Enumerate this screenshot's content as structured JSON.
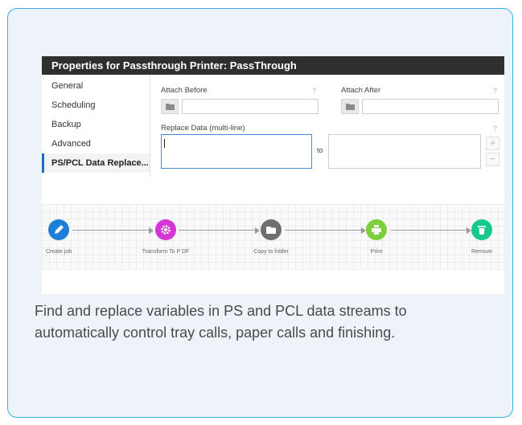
{
  "dialog": {
    "title": "Properties for Passthrough Printer: PassThrough",
    "nav": [
      {
        "label": "General"
      },
      {
        "label": "Scheduling"
      },
      {
        "label": "Backup"
      },
      {
        "label": "Advanced"
      },
      {
        "label": "PS/PCL Data Replace..."
      }
    ],
    "attach_before_label": "Attach Before",
    "attach_after_label": "Attach After",
    "replace_label": "Replace Data (multi-line)",
    "help_glyph": "?",
    "to_label": "to",
    "add_glyph": "+",
    "remove_glyph": "−",
    "attach_before_value": "",
    "attach_after_value": "",
    "replace_from_value": "",
    "replace_to_value": ""
  },
  "workflow": {
    "steps": [
      {
        "label": "Create job",
        "icon": "pencil-icon",
        "color": "#1e7fd6"
      },
      {
        "label": "Transform To P DF",
        "icon": "gear-icon",
        "color": "#d535d2"
      },
      {
        "label": "Copy to folder",
        "icon": "folder-icon",
        "color": "#6e6e6e"
      },
      {
        "label": "Print",
        "icon": "printer-icon",
        "color": "#7bd13a"
      },
      {
        "label": "Remove",
        "icon": "trash-icon",
        "color": "#16c98a"
      }
    ]
  },
  "colors": {
    "card_bg": "#edf3f8",
    "card_border": "#3aaee6",
    "titlebar": "#2f2f2f",
    "active_nav_accent": "#1a6fc4"
  },
  "caption": "Find and replace variables in PS and PCL data streams to automatically control tray calls, paper calls and finishing."
}
